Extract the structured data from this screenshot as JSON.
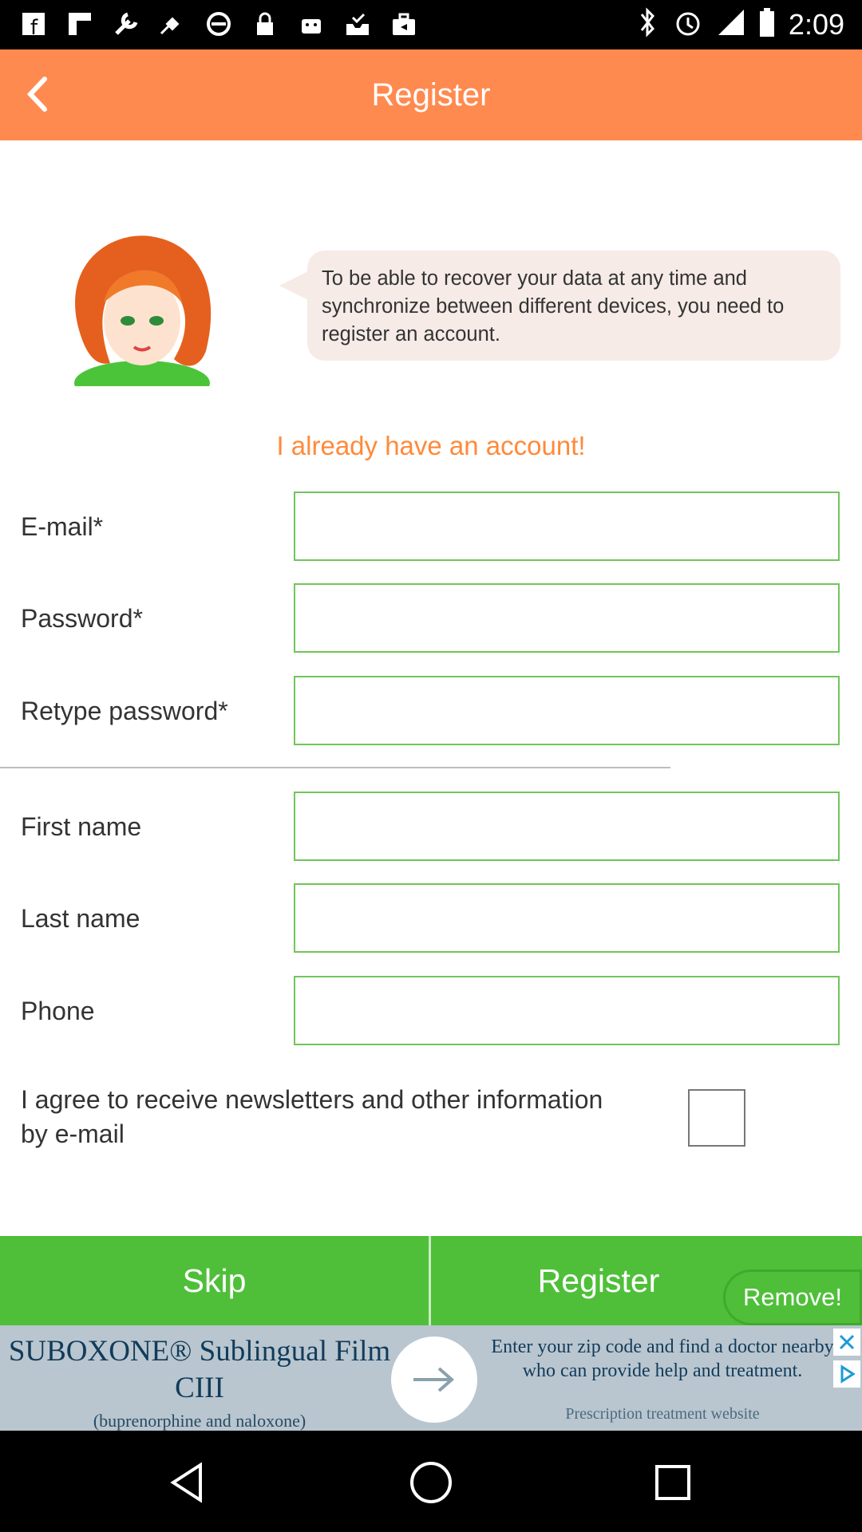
{
  "status_bar": {
    "time": "2:09",
    "left_icons": [
      "facebook-icon",
      "flipboard-icon",
      "wrench-icon",
      "satellite-icon",
      "blocked-icon",
      "lock-icon",
      "android-icon",
      "inbox-check-icon",
      "briefcase-icon"
    ],
    "right_icons": [
      "bluetooth-icon",
      "alarm-icon",
      "signal-icon",
      "battery-icon"
    ]
  },
  "appbar": {
    "title": "Register"
  },
  "intro": {
    "message": "To be able to recover your data at any time and synchronize between different devices, you need to register an account."
  },
  "login_link": "I already have an account!",
  "form": {
    "email_label": "E-mail*",
    "password_label": "Password*",
    "retype_label": "Retype password*",
    "first_name_label": "First name",
    "last_name_label": "Last name",
    "phone_label": "Phone",
    "newsletter_label": "I agree to receive newsletters and other information by e-mail",
    "newsletter_checked": false
  },
  "buttons": {
    "skip": "Skip",
    "register": "Register",
    "remove": "Remove!"
  },
  "ad": {
    "headline": "SUBOXONE® Sublingual Film CIII",
    "subline": "(buprenorphine and naloxone)",
    "body": "Enter your zip code and find a doctor nearby who can provide help and treatment.",
    "footer": "Prescription treatment website"
  },
  "colors": {
    "accent_orange": "#ff8a4f",
    "link_orange": "#ff8a3a",
    "green": "#4fbf3a",
    "field_border": "#6fc65a"
  }
}
